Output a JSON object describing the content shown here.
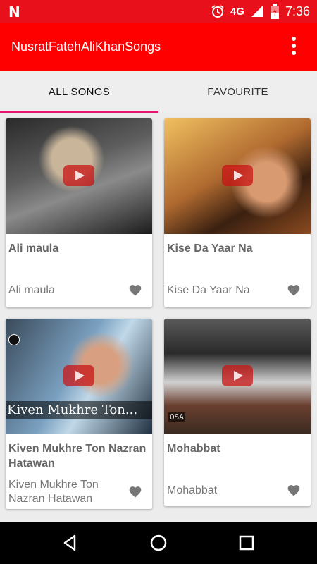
{
  "status_bar": {
    "network": "4G",
    "time": "7:36"
  },
  "app_bar": {
    "title": "NusratFatehAliKhanSongs"
  },
  "tabs": [
    {
      "label": "ALL SONGS",
      "selected": true
    },
    {
      "label": "FAVOURITE",
      "selected": false
    }
  ],
  "songs": [
    {
      "title": "Ali maula",
      "subtitle": "Ali maula",
      "thumb_text": ""
    },
    {
      "title": "Kise Da Yaar Na",
      "subtitle": "Kise Da Yaar Na",
      "thumb_text": ""
    },
    {
      "title": "Kiven Mukhre Ton Nazran Hatawan",
      "subtitle": "Kiven Mukhre Ton Nazran Hatawan",
      "thumb_text": "Kiven Mukhre Ton..."
    },
    {
      "title": "Mohabbat",
      "subtitle": "Mohabbat",
      "thumb_text": "OSA"
    }
  ],
  "colors": {
    "status_bar": "#e8101a",
    "app_bar": "#ff0000",
    "tab_indicator": "#e5186b"
  }
}
